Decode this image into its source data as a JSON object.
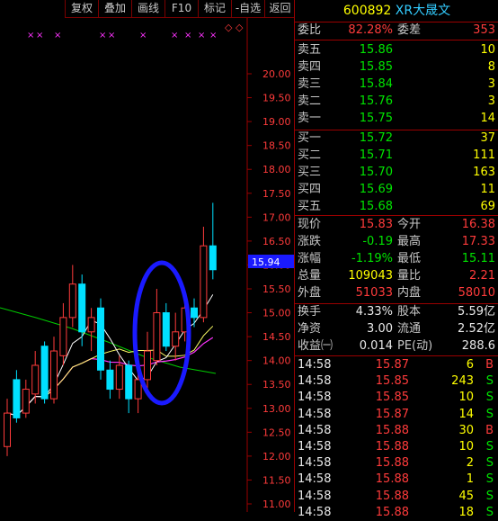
{
  "toolbar": {
    "buttons": [
      "复权",
      "叠加",
      "画线",
      "F10",
      "标记",
      "-自选",
      "返回"
    ]
  },
  "chart": {
    "price_ticks": [
      "20.00",
      "19.50",
      "19.00",
      "18.50",
      "18.00",
      "17.50",
      "17.00",
      "16.50",
      "16.00",
      "15.50",
      "15.00",
      "14.50",
      "14.00",
      "13.50",
      "13.00",
      "12.50",
      "12.00",
      "11.50",
      "11.00"
    ],
    "current_price_label": "15.94",
    "marker_symbol": "×",
    "diamond_symbol": "◇",
    "colors": {
      "up": "#ff3b3b",
      "down": "#00e0ff",
      "ma5": "#ffffff",
      "ma10": "#ffff66",
      "ma20": "#ff33ff",
      "ma60": "#00cc00",
      "circle": "#1a1aff"
    }
  },
  "chart_data": {
    "type": "candlestick",
    "y_range": [
      11.0,
      20.0
    ],
    "current_price": 15.94,
    "candles": [
      {
        "o": 12.2,
        "c": 12.9,
        "h": 13.2,
        "l": 12.0
      },
      {
        "o": 13.6,
        "c": 12.8,
        "h": 13.8,
        "l": 12.7
      },
      {
        "o": 12.9,
        "c": 13.4,
        "h": 13.6,
        "l": 12.8
      },
      {
        "o": 13.3,
        "c": 13.9,
        "h": 14.2,
        "l": 13.1
      },
      {
        "o": 14.3,
        "c": 13.2,
        "h": 14.4,
        "l": 13.1
      },
      {
        "o": 13.2,
        "c": 14.2,
        "h": 14.5,
        "l": 13.1
      },
      {
        "o": 14.1,
        "c": 14.9,
        "h": 15.2,
        "l": 13.9
      },
      {
        "o": 14.9,
        "c": 15.6,
        "h": 16.0,
        "l": 14.7
      },
      {
        "o": 15.6,
        "c": 14.6,
        "h": 15.8,
        "l": 14.3
      },
      {
        "o": 14.6,
        "c": 14.9,
        "h": 15.1,
        "l": 14.2
      },
      {
        "o": 15.1,
        "c": 13.8,
        "h": 15.3,
        "l": 13.6
      },
      {
        "o": 13.8,
        "c": 13.4,
        "h": 14.0,
        "l": 13.2
      },
      {
        "o": 13.4,
        "c": 13.9,
        "h": 14.1,
        "l": 13.2
      },
      {
        "o": 13.9,
        "c": 13.2,
        "h": 14.0,
        "l": 12.9
      },
      {
        "o": 13.2,
        "c": 13.6,
        "h": 13.9,
        "l": 12.9
      },
      {
        "o": 13.6,
        "c": 14.2,
        "h": 14.6,
        "l": 13.4
      },
      {
        "o": 14.0,
        "c": 15.0,
        "h": 15.5,
        "l": 13.9
      },
      {
        "o": 15.0,
        "c": 14.3,
        "h": 15.2,
        "l": 14.2
      },
      {
        "o": 14.3,
        "c": 14.6,
        "h": 15.0,
        "l": 14.0
      },
      {
        "o": 14.6,
        "c": 15.1,
        "h": 15.4,
        "l": 14.4
      },
      {
        "o": 15.1,
        "c": 14.9,
        "h": 15.3,
        "l": 14.7
      },
      {
        "o": 14.9,
        "c": 16.4,
        "h": 16.8,
        "l": 14.8
      },
      {
        "o": 16.4,
        "c": 15.9,
        "h": 17.3,
        "l": 15.7
      }
    ]
  },
  "quote": {
    "code": "600892",
    "name": "XR大晟文",
    "weibi_label": "委比",
    "weibi": "82.28%",
    "weicha_label": "委差",
    "weicha": "353",
    "asks": [
      {
        "label": "卖五",
        "price": "15.86",
        "vol": "10"
      },
      {
        "label": "卖四",
        "price": "15.85",
        "vol": "8"
      },
      {
        "label": "卖三",
        "price": "15.84",
        "vol": "3"
      },
      {
        "label": "卖二",
        "price": "15.76",
        "vol": "3"
      },
      {
        "label": "卖一",
        "price": "15.75",
        "vol": "14"
      }
    ],
    "bids": [
      {
        "label": "买一",
        "price": "15.72",
        "vol": "37"
      },
      {
        "label": "买二",
        "price": "15.71",
        "vol": "111"
      },
      {
        "label": "买三",
        "price": "15.70",
        "vol": "163"
      },
      {
        "label": "买四",
        "price": "15.69",
        "vol": "11"
      },
      {
        "label": "买五",
        "price": "15.68",
        "vol": "69"
      }
    ],
    "stats": [
      {
        "l1": "现价",
        "v1": "15.83",
        "c1": "red",
        "l2": "今开",
        "v2": "16.38",
        "c2": "red"
      },
      {
        "l1": "涨跌",
        "v1": "-0.19",
        "c1": "green",
        "l2": "最高",
        "v2": "17.33",
        "c2": "red"
      },
      {
        "l1": "涨幅",
        "v1": "-1.19%",
        "c1": "green",
        "l2": "最低",
        "v2": "15.11",
        "c2": "green"
      },
      {
        "l1": "总量",
        "v1": "109043",
        "c1": "yellow",
        "l2": "量比",
        "v2": "2.21",
        "c2": "red"
      },
      {
        "l1": "外盘",
        "v1": "51033",
        "c1": "red",
        "l2": "内盘",
        "v2": "58010",
        "c2": "red"
      }
    ],
    "fund": [
      {
        "l1": "换手",
        "v1": "4.33%",
        "l2": "股本",
        "v2": "5.59亿"
      },
      {
        "l1": "净资",
        "v1": "3.00",
        "l2": "流通",
        "v2": "2.52亿"
      },
      {
        "l1": "收益㈠",
        "v1": "0.014",
        "l2": "PE(动)",
        "v2": "288.6"
      }
    ],
    "ticks": [
      {
        "t": "14:58",
        "p": "15.87",
        "v": "6",
        "s": "B"
      },
      {
        "t": "14:58",
        "p": "15.85",
        "v": "243",
        "s": "S"
      },
      {
        "t": "14:58",
        "p": "15.85",
        "v": "10",
        "s": "S"
      },
      {
        "t": "14:58",
        "p": "15.87",
        "v": "14",
        "s": "S"
      },
      {
        "t": "14:58",
        "p": "15.88",
        "v": "30",
        "s": "B"
      },
      {
        "t": "14:58",
        "p": "15.88",
        "v": "10",
        "s": "S"
      },
      {
        "t": "14:58",
        "p": "15.88",
        "v": "2",
        "s": "S"
      },
      {
        "t": "14:58",
        "p": "15.88",
        "v": "1",
        "s": "S"
      },
      {
        "t": "14:58",
        "p": "15.88",
        "v": "45",
        "s": "S"
      },
      {
        "t": "14:58",
        "p": "15.88",
        "v": "18",
        "s": "S"
      }
    ]
  }
}
